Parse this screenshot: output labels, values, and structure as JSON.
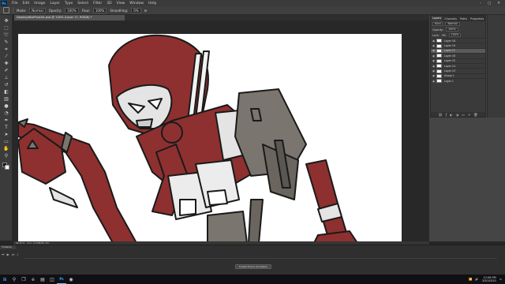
{
  "app": {
    "menu": [
      "File",
      "Edit",
      "Image",
      "Layer",
      "Type",
      "Select",
      "Filter",
      "3D",
      "View",
      "Window",
      "Help"
    ],
    "window_controls": [
      "–",
      "□",
      "✕"
    ]
  },
  "options_bar": {
    "mode_label": "Mode:",
    "mode_value": "Normal",
    "opacity_label": "Opacity:",
    "opacity_value": "100%",
    "flow_label": "Flow:",
    "flow_value": "100%",
    "smoothing_label": "Smoothing:",
    "smoothing_value": "0%"
  },
  "document": {
    "tab_title": "DeadeyeBotFinalArt.psd @ 100% (Layer 17, RGB/8) *"
  },
  "status": {
    "zoom": "66.67%",
    "doc_size": "Doc: 4.50M/80.1M"
  },
  "layers_panel": {
    "tabs": [
      "Layers",
      "Channels",
      "Paths",
      "Properties"
    ],
    "kind_label": "Kind",
    "blend_mode": "Normal",
    "opacity_label": "Opacity:",
    "opacity_value": "100%",
    "lock_label": "Lock:",
    "fill_label": "Fill:",
    "fill_value": "100%",
    "layers": [
      {
        "name": "Layer 18",
        "selected": false
      },
      {
        "name": "Layer 19",
        "selected": false
      },
      {
        "name": "Layer 17",
        "selected": true
      },
      {
        "name": "Layer 16",
        "selected": false
      },
      {
        "name": "Layer 15",
        "selected": false
      },
      {
        "name": "Layer 14",
        "selected": false
      },
      {
        "name": "Layer 13",
        "selected": false
      },
      {
        "name": "Group 1",
        "selected": false
      },
      {
        "name": "Layer 1",
        "selected": false
      }
    ],
    "footer_icons": [
      "link-icon",
      "fx-icon",
      "mask-icon",
      "adjustment-icon",
      "folder-icon",
      "new-layer-icon",
      "trash-icon"
    ]
  },
  "timeline": {
    "tab_label": "Timeline",
    "create_button": "Create Frame Animation"
  },
  "taskbar": {
    "time": "12:06 PM",
    "date": "3/30/2020"
  },
  "colors": {
    "cloak_red": "#8e3030",
    "metal_gray": "#7a756e",
    "outline": "#1a1a1a",
    "skin_light": "#e4e4e4",
    "accent_blue": "#31a8ff"
  }
}
